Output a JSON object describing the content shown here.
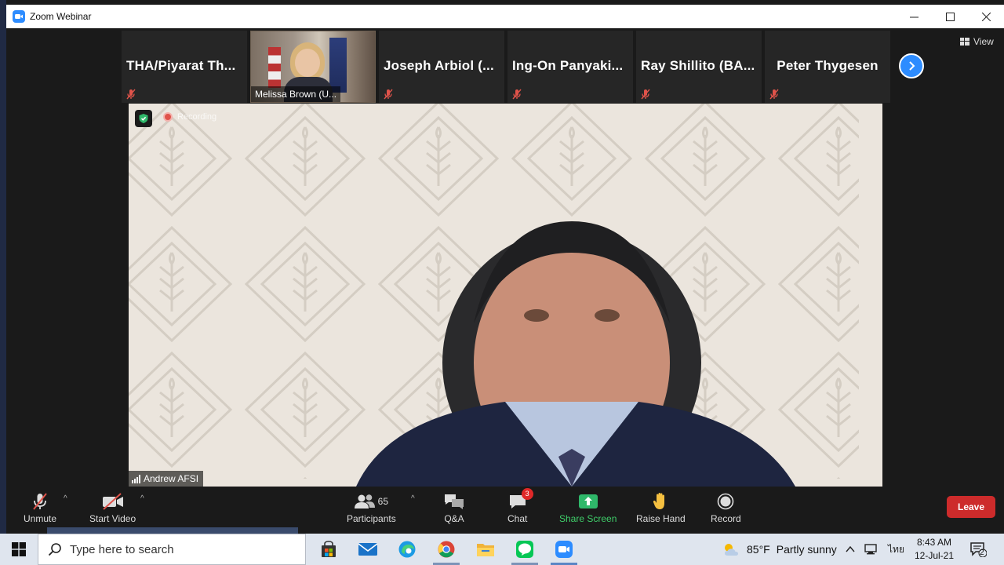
{
  "window": {
    "title": "Zoom Webinar"
  },
  "thumbnails": [
    {
      "name": "THA/Piyarat  Th...",
      "type": "name"
    },
    {
      "name": "Melissa Brown (U...",
      "type": "video"
    },
    {
      "name": "Joseph  Arbiol  (...",
      "type": "name"
    },
    {
      "name": "Ing-On  Panyaki...",
      "type": "name"
    },
    {
      "name": "Ray  Shillito  (BA...",
      "type": "name"
    },
    {
      "name": "Peter Thygesen",
      "type": "name"
    }
  ],
  "view_button": {
    "label": "View"
  },
  "main_video": {
    "recording_label": "Recording",
    "speaker_name": "Andrew AFSI"
  },
  "toolbar": {
    "unmute": "Unmute",
    "start_video": "Start Video",
    "participants": "Participants",
    "participants_count": "65",
    "qa": "Q&A",
    "chat": "Chat",
    "chat_badge": "3",
    "share_screen": "Share Screen",
    "raise_hand": "Raise Hand",
    "record": "Record",
    "leave": "Leave"
  },
  "taskbar": {
    "search_placeholder": "Type here to search",
    "weather_temp": "85°F",
    "weather_desc": "Partly sunny",
    "language": "ไทย",
    "time": "8:43 AM",
    "date": "12-Jul-21",
    "notification_count": "2"
  },
  "colors": {
    "zoom_blue": "#2d8cff",
    "leave_red": "#cd2b2b",
    "share_green": "#3fcf6a",
    "recording_red": "#e0534a"
  }
}
